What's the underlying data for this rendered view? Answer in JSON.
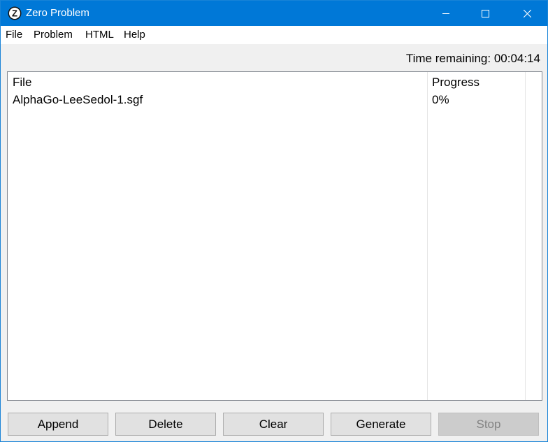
{
  "window": {
    "title": "Zero Problem",
    "icon": "zero-problem-app-icon",
    "icon_letter": "Z",
    "colors": {
      "titlebar": "#0078d7",
      "title_text": "#ffffff"
    }
  },
  "menu": {
    "items": [
      {
        "label": "File"
      },
      {
        "label": "Problem"
      },
      {
        "label": "HTML"
      },
      {
        "label": "Help"
      }
    ]
  },
  "status": {
    "time_remaining": "Time remaining: 00:04:14"
  },
  "list": {
    "columns": [
      {
        "label": "File"
      },
      {
        "label": "Progress"
      }
    ],
    "rows": [
      {
        "file": "AlphaGo-LeeSedol-1.sgf",
        "progress": "0%"
      }
    ]
  },
  "buttons": {
    "append": "Append",
    "delete": "Delete",
    "clear": "Clear",
    "generate": "Generate",
    "stop": "Stop"
  }
}
